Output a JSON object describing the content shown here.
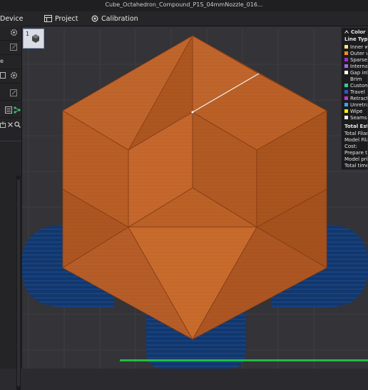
{
  "window": {
    "title": "Cube_Octahedron_Compound_P1S_04mmNozzle_016..."
  },
  "menubar": {
    "tabs": [
      {
        "label": "Device",
        "icon": "device-icon"
      },
      {
        "label": "Project",
        "icon": "project-icon"
      },
      {
        "label": "Calibration",
        "icon": "calibration-icon"
      }
    ]
  },
  "sidebar": {
    "partial_text": "e",
    "icons": [
      "gear-icon",
      "edit-icon",
      "plate-icon",
      "gear-icon",
      "edit-icon",
      "list-icon",
      "tree-icon",
      "export-icon",
      "close-icon",
      "search-icon"
    ]
  },
  "plate": {
    "number": "1"
  },
  "legend": {
    "header": "Color Scheme",
    "line_type_label": "Line Type",
    "items": [
      {
        "label": "Inner wall",
        "color": "#ffe680"
      },
      {
        "label": "Outer wall",
        "color": "#ff8c1a"
      },
      {
        "label": "Sparse infill",
        "color": "#9933cc"
      },
      {
        "label": "Internal solid infill",
        "color": "#a366ff"
      },
      {
        "label": "Gap infill",
        "color": "#ffffff"
      },
      {
        "label": "Brim",
        "color": "#1c1c1e"
      },
      {
        "label": "Custom",
        "color": "#33cc99"
      },
      {
        "label": "Travel",
        "color": "#3355cc"
      },
      {
        "label": "Retract",
        "color": "#cc33cc"
      },
      {
        "label": "Unretract",
        "color": "#33aaff"
      },
      {
        "label": "Wipe",
        "color": "#ffee00"
      },
      {
        "label": "Seams",
        "color": "#f0f0f0"
      }
    ],
    "stats_title": "Total Estimation",
    "stats": [
      "Total Filament:",
      "Model Filament:",
      "Cost:",
      "Prepare time:",
      "Model printing time:",
      "Total time:"
    ]
  },
  "colors": {
    "model": "#c86428",
    "brim": "#143e7a",
    "background": "#333338",
    "progress": "#22bb44"
  }
}
